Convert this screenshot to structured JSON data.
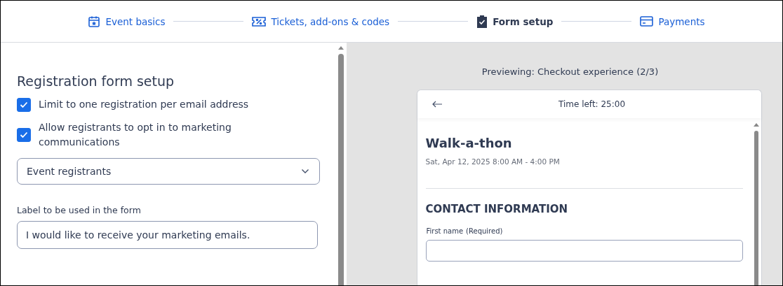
{
  "steps": [
    {
      "label": "Event basics",
      "selected": false
    },
    {
      "label": "Tickets, add-ons & codes",
      "selected": false
    },
    {
      "label": "Form setup",
      "selected": true
    },
    {
      "label": "Payments",
      "selected": false
    }
  ],
  "settings": {
    "title": "Registration form setup",
    "checkboxes": [
      {
        "label": "Limit to one registration per email address",
        "checked": true
      },
      {
        "label": "Allow registrants to opt in to marketing communications",
        "checked": true
      }
    ],
    "dropdown": {
      "value": "Event registrants"
    },
    "label_field": {
      "label": "Label to be used in the form",
      "value": "I would like to receive your marketing emails."
    }
  },
  "preview": {
    "caption": "Previewing: Checkout experience (2/3)",
    "timer": "Time left: 25:00",
    "event_title": "Walk-a-thon",
    "event_date": "Sat, Apr 12, 2025 8:00 AM - 4:00 PM",
    "section_title": "CONTACT INFORMATION",
    "field": {
      "label": "First name",
      "required": "(Required)"
    }
  }
}
